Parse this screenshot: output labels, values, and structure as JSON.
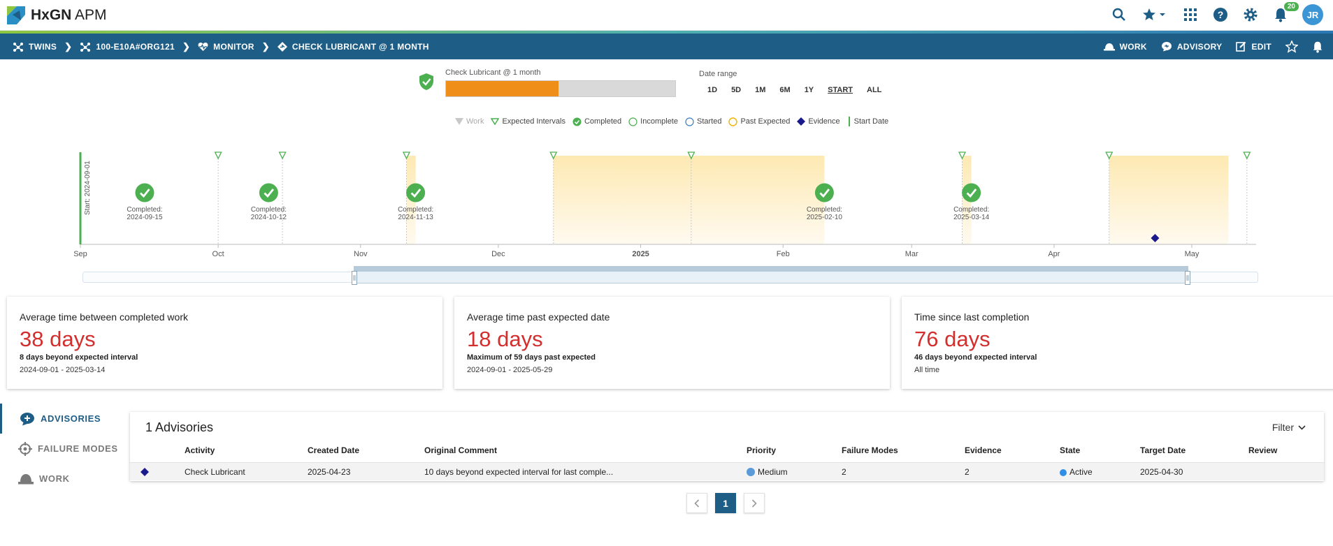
{
  "app": {
    "brand_bold": "HxGN",
    "brand_rest": " APM"
  },
  "topbar": {
    "notifications_count": "20",
    "avatar_initials": "JR"
  },
  "breadcrumb": [
    {
      "label": "TWINS"
    },
    {
      "label": "100-E10A#ORG121"
    },
    {
      "label": "MONITOR"
    },
    {
      "label": "CHECK LUBRICANT @ 1 MONTH"
    }
  ],
  "nav_actions": {
    "work": "WORK",
    "advisory": "ADVISORY",
    "edit": "EDIT"
  },
  "status": {
    "title": "Check Lubricant @ 1 month",
    "progress_fraction": 0.49
  },
  "date_range": {
    "label": "Date range",
    "options": [
      "1D",
      "5D",
      "1M",
      "6M",
      "1Y",
      "START",
      "ALL"
    ],
    "selected": "START"
  },
  "legend": {
    "work": "Work",
    "expected": "Expected Intervals",
    "completed": "Completed",
    "incomplete": "Incomplete",
    "started": "Started",
    "past_expected": "Past Expected",
    "evidence": "Evidence",
    "start_date": "Start Date"
  },
  "chart_data": {
    "type": "timeline",
    "x_range": [
      "2024-09-01",
      "2025-05-15"
    ],
    "x_ticks": [
      "Sep",
      "Oct",
      "Nov",
      "Dec",
      "2025",
      "Feb",
      "Mar",
      "Apr",
      "May"
    ],
    "start_label": "Start: 2024-09-01",
    "start_date": "2024-09-01",
    "completed_prefix": "Completed:",
    "completed": [
      "2024-09-15",
      "2024-10-12",
      "2024-11-13",
      "2025-02-10",
      "2025-03-14"
    ],
    "expected_intervals": [
      "2024-10-01",
      "2024-10-15",
      "2024-11-11",
      "2024-12-13",
      "2025-01-12",
      "2025-03-12",
      "2025-04-13",
      "2025-05-13"
    ],
    "past_expected_ranges": [
      [
        "2024-11-11",
        "2024-11-13"
      ],
      [
        "2024-12-13",
        "2025-02-10"
      ],
      [
        "2025-03-12",
        "2025-03-14"
      ],
      [
        "2025-04-13",
        "2025-05-09"
      ]
    ],
    "evidence": [
      "2025-04-23"
    ]
  },
  "cards": [
    {
      "title": "Average time between completed work",
      "value": "38 days",
      "sub": "8 days beyond expected interval",
      "range": "2024-09-01 - 2025-03-14"
    },
    {
      "title": "Average time past expected date",
      "value": "18 days",
      "sub": "Maximum of 59 days past expected",
      "range": "2024-09-01 - 2025-05-29"
    },
    {
      "title": "Time since last completion",
      "value": "76 days",
      "sub": "46 days beyond expected interval",
      "range": "All time"
    }
  ],
  "sidenav": [
    "ADVISORIES",
    "FAILURE MODES",
    "WORK"
  ],
  "advisories": {
    "title": "1 Advisories",
    "filter_label": "Filter",
    "columns": [
      "Activity",
      "Created Date",
      "Original Comment",
      "Priority",
      "Failure Modes",
      "Evidence",
      "State",
      "Target Date",
      "Review"
    ],
    "rows": [
      {
        "activity": "Check Lubricant",
        "created": "2025-04-23",
        "comment": "10 days beyond expected interval for last comple...",
        "priority": "Medium",
        "failure_modes": "2",
        "evidence": "2",
        "state": "Active",
        "target": "2025-04-30",
        "review": ""
      }
    ]
  },
  "pagination": {
    "current": "1"
  },
  "colors": {
    "navbar": "#1d5d86",
    "accent_orange": "#ef8f1a",
    "completed_green": "#4caf50",
    "value_red": "#d32f2f",
    "evidence_navy": "#1a1a8c",
    "past_expected_fill": "#fde9b2"
  }
}
